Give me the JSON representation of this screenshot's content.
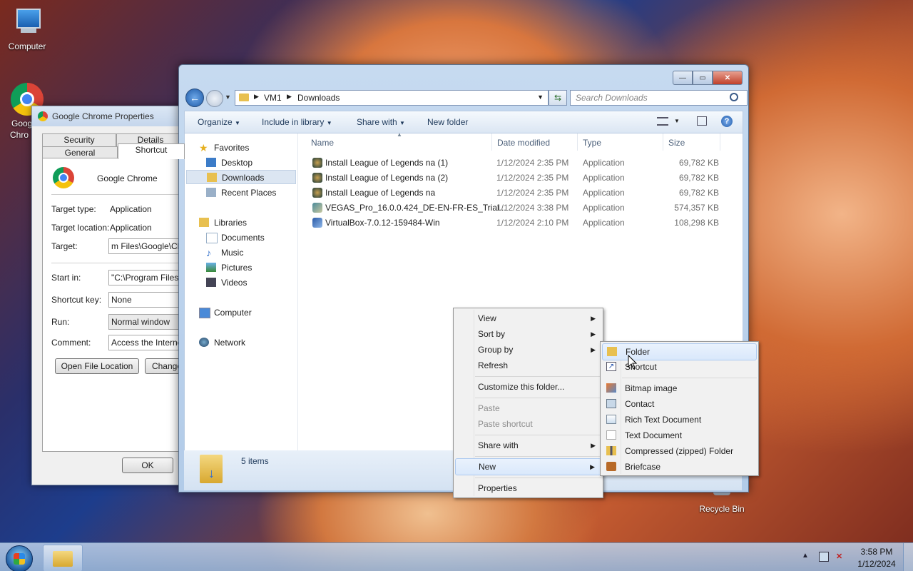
{
  "desktop": {
    "computer": "Computer",
    "chrome": "Google Chrome",
    "chrome_short_1": "Goog",
    "chrome_short_2": "Chro",
    "recycle": "Recycle Bin"
  },
  "props": {
    "title": "Google Chrome Properties",
    "tabs": {
      "security": "Security",
      "details": "Details",
      "general": "General",
      "shortcut": "Shortcut"
    },
    "app_name": "Google Chrome",
    "target_type_label": "Target type:",
    "target_type_value": "Application",
    "target_location_label": "Target location:",
    "target_location_value": "Application",
    "target_label": "Target:",
    "target_value": "m Files\\Google\\Chrome",
    "start_in_label": "Start in:",
    "start_in_value": "\"C:\\Program Files\\G",
    "shortcut_key_label": "Shortcut key:",
    "shortcut_key_value": "None",
    "run_label": "Run:",
    "run_value": "Normal window",
    "comment_label": "Comment:",
    "comment_value": "Access the Internet",
    "open_file_location": "Open File Location",
    "change_icon": "Change",
    "ok": "OK"
  },
  "explorer": {
    "path": [
      "VM1",
      "Downloads"
    ],
    "search_placeholder": "Search Downloads",
    "toolbar": {
      "organize": "Organize",
      "include": "Include in library",
      "share": "Share with",
      "new_folder": "New folder"
    },
    "nav": {
      "favorites": "Favorites",
      "desktop": "Desktop",
      "downloads": "Downloads",
      "recent": "Recent Places",
      "libraries": "Libraries",
      "documents": "Documents",
      "music": "Music",
      "pictures": "Pictures",
      "videos": "Videos",
      "computer": "Computer",
      "network": "Network"
    },
    "columns": {
      "name": "Name",
      "date": "Date modified",
      "type": "Type",
      "size": "Size"
    },
    "files": [
      {
        "name": "Install League of Legends na (1)",
        "date": "1/12/2024 2:35 PM",
        "type": "Application",
        "size": "69,782 KB"
      },
      {
        "name": "Install League of Legends na (2)",
        "date": "1/12/2024 2:35 PM",
        "type": "Application",
        "size": "69,782 KB"
      },
      {
        "name": "Install League of Legends na",
        "date": "1/12/2024 2:35 PM",
        "type": "Application",
        "size": "69,782 KB"
      },
      {
        "name": "VEGAS_Pro_16.0.0.424_DE-EN-FR-ES_Trial...",
        "date": "1/12/2024 3:38 PM",
        "type": "Application",
        "size": "574,357 KB"
      },
      {
        "name": "VirtualBox-7.0.12-159484-Win",
        "date": "1/12/2024 2:10 PM",
        "type": "Application",
        "size": "108,298 KB"
      }
    ],
    "status": "5 items"
  },
  "context_menu": {
    "view": "View",
    "sort": "Sort by",
    "group": "Group by",
    "refresh": "Refresh",
    "customize": "Customize this folder...",
    "paste": "Paste",
    "paste_shortcut": "Paste shortcut",
    "share": "Share with",
    "new": "New",
    "properties": "Properties"
  },
  "new_menu": {
    "folder": "Folder",
    "shortcut": "Shortcut",
    "bitmap": "Bitmap image",
    "contact": "Contact",
    "rtf": "Rich Text Document",
    "text": "Text Document",
    "zip": "Compressed (zipped) Folder",
    "briefcase": "Briefcase"
  },
  "taskbar": {
    "time": "3:58 PM",
    "date": "1/12/2024"
  }
}
